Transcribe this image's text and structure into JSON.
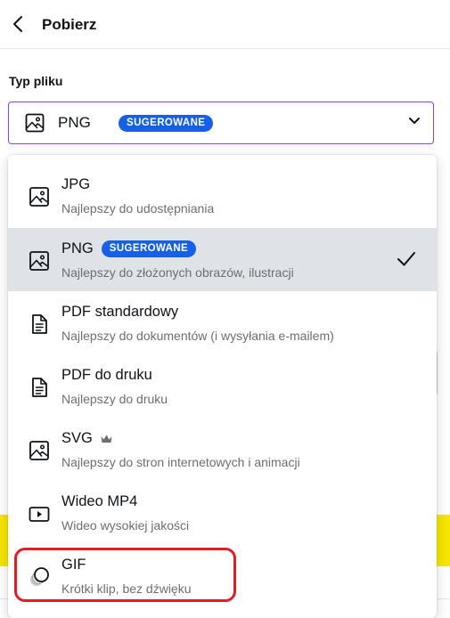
{
  "header": {
    "title": "Pobierz",
    "back_icon": "chevron-left-icon"
  },
  "file_type": {
    "label": "Typ pliku",
    "selected": {
      "name": "PNG",
      "badge": "SUGEROWANE",
      "icon": "image-icon"
    },
    "chevron_icon": "chevron-down-icon",
    "accent": "#8b3dff"
  },
  "options": [
    {
      "name": "JPG",
      "description": "Najlepszy do udostępniania",
      "icon": "image-icon",
      "badge": "",
      "selected": false
    },
    {
      "name": "PNG",
      "description": "Najlepszy do złożonych obrazów, ilustracji",
      "icon": "image-icon",
      "badge": "SUGEROWANE",
      "selected": true
    },
    {
      "name": "PDF standardowy",
      "description": "Najlepszy do dokumentów (i wysyłania e-mailem)",
      "icon": "document-icon",
      "badge": "",
      "selected": false
    },
    {
      "name": "PDF do druku",
      "description": "Najlepszy do druku",
      "icon": "document-icon",
      "badge": "",
      "selected": false
    },
    {
      "name": "SVG",
      "description": "Najlepszy do stron internetowych i animacji",
      "icon": "image-icon",
      "badge": "",
      "premium_icon": "crown-icon",
      "selected": false
    },
    {
      "name": "Wideo MP4",
      "description": "Wideo wysokiej jakości",
      "icon": "video-icon",
      "badge": "",
      "selected": false
    },
    {
      "name": "GIF",
      "description": "Krótki klip, bez dźwięku",
      "icon": "gif-icon",
      "badge": "",
      "selected": false
    }
  ],
  "colors": {
    "badge": "#1660e8",
    "selected_row": "#dfe2e6",
    "highlight": "#e31b23"
  }
}
